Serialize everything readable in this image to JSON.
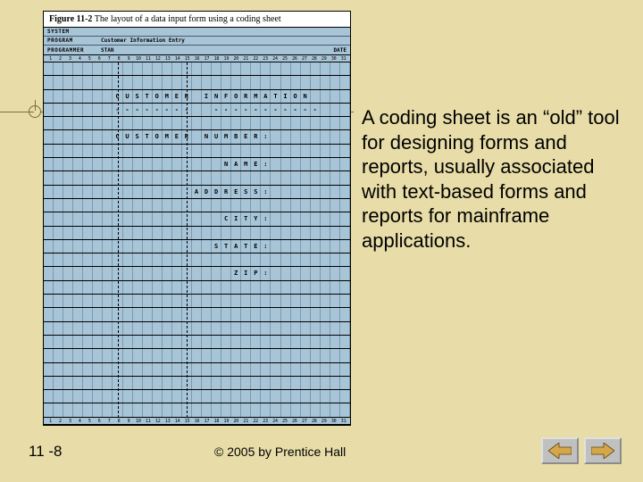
{
  "figure": {
    "label": "Figure 11-2",
    "caption": "The layout of a data input form using a coding sheet",
    "header": {
      "system_label": "SYSTEM",
      "program_label": "PROGRAM",
      "program_value": "Customer Information Entry",
      "programmer_label": "PROGRAMMER",
      "programmer_value": "STAN",
      "date_label": "DATE"
    },
    "ruler": [
      "1",
      "2",
      "3",
      "4",
      "5",
      "6",
      "7",
      "8",
      "9",
      "10",
      "11",
      "12",
      "13",
      "14",
      "15",
      "16",
      "17",
      "18",
      "19",
      "20",
      "21",
      "22",
      "23",
      "24",
      "25",
      "26",
      "27",
      "28",
      "29",
      "30",
      "31"
    ],
    "rows": [
      {
        "cells": []
      },
      {
        "cells": []
      },
      {
        "text": "CUSTOMER INFORMATION",
        "start": 8
      },
      {
        "dashes": true,
        "start": 8,
        "groups": [
          8,
          11
        ]
      },
      {
        "cells": []
      },
      {
        "text": "CUSTOMER NUMBER:",
        "start": 8
      },
      {
        "cells": []
      },
      {
        "text": "NAME:",
        "start": 19
      },
      {
        "cells": []
      },
      {
        "text": "ADDRESS:",
        "start": 16
      },
      {
        "cells": []
      },
      {
        "text": "CITY:",
        "start": 19
      },
      {
        "cells": []
      },
      {
        "text": "STATE:",
        "start": 18
      },
      {
        "cells": []
      },
      {
        "text": "ZIP:",
        "start": 20
      },
      {
        "cells": []
      },
      {
        "cells": []
      },
      {
        "cells": []
      },
      {
        "cells": []
      },
      {
        "cells": []
      },
      {
        "cells": []
      },
      {
        "cells": []
      },
      {
        "cells": []
      },
      {
        "cells": []
      },
      {
        "cells": []
      }
    ]
  },
  "body_text": "A coding sheet is an “old” tool for designing forms and reports, usually associated with text-based forms and reports for mainframe applications.",
  "page_number": "11 -8",
  "copyright": "© 2005 by Prentice Hall"
}
